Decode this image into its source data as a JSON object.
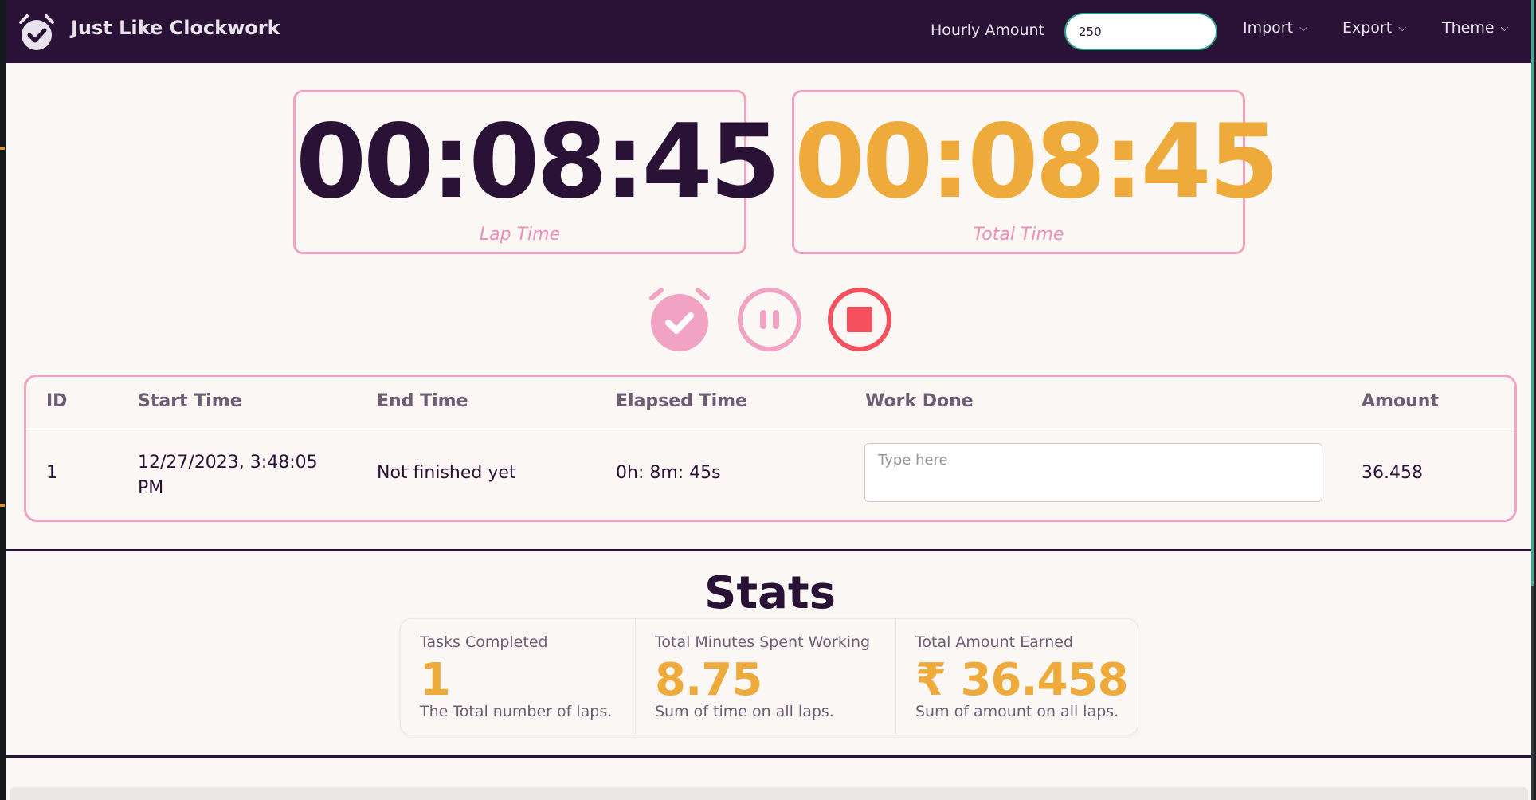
{
  "navbar": {
    "brand": "Just Like Clockwork",
    "hourly_label": "Hourly Amount",
    "hourly_value": "250",
    "menus": [
      "Import",
      "Export",
      "Theme"
    ]
  },
  "timers": {
    "lap_value": "00:08:45",
    "lap_label": "Lap Time",
    "total_value": "00:08:45",
    "total_label": "Total Time"
  },
  "colors": {
    "nav_bg": "#2a1136",
    "primary": "#2a1136",
    "accent": "#eeab3c",
    "pink": "#f1a3c4",
    "stop": "#f4505e",
    "background": "#faf7f5"
  },
  "controls": {
    "icons": [
      "alarm-check-icon",
      "pause-icon",
      "stop-icon"
    ]
  },
  "table": {
    "headers": [
      "ID",
      "Start Time",
      "End Time",
      "Elapsed Time",
      "Work Done",
      "Amount"
    ],
    "rows": [
      {
        "id": "1",
        "start_line1": "12/27/2023, 3:48:05",
        "start_line2": "PM",
        "end": "Not finished yet",
        "elapsed": "0h: 8m: 45s",
        "work_placeholder": "Type here",
        "amount": "36.458"
      }
    ]
  },
  "stats": {
    "title": "Stats",
    "items": [
      {
        "title": "Tasks Completed",
        "value": "1",
        "desc": "The Total number of laps."
      },
      {
        "title": "Total Minutes Spent Working",
        "value": "8.75",
        "desc": "Sum of time on all laps."
      },
      {
        "title": "Total Amount Earned",
        "value": "₹ 36.458",
        "desc": "Sum of amount on all laps."
      }
    ]
  }
}
